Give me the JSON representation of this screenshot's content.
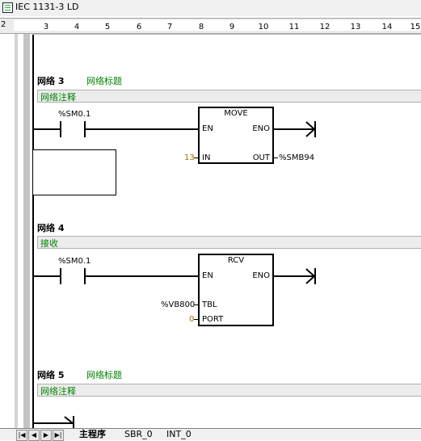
{
  "window": {
    "title": "IEC 1131-3 LD"
  },
  "ruler": {
    "start": "2",
    "ticks": [
      "3",
      "4",
      "5",
      "6",
      "7",
      "8",
      "9",
      "10",
      "11",
      "12",
      "13",
      "14",
      "15"
    ]
  },
  "networks": [
    {
      "title": "网络 3",
      "subtitle": "网络标题",
      "comment": "网络注释",
      "contact": "%SM0.1",
      "block": {
        "name": "MOVE",
        "en": "EN",
        "eno": "ENO",
        "in_pin": "IN",
        "in_value": "13",
        "out_pin": "OUT",
        "out_value": "%SMB94"
      }
    },
    {
      "title": "网络 4",
      "subtitle": "",
      "comment": "接收",
      "contact": "%SM0.1",
      "block": {
        "name": "RCV",
        "en": "EN",
        "eno": "ENO",
        "tbl_pin": "TBL",
        "tbl_value": "%VB800",
        "port_pin": "PORT",
        "port_value": "0"
      }
    },
    {
      "title": "网络 5",
      "subtitle": "网络标题",
      "comment": "网络注释"
    }
  ],
  "tabs": [
    "主程序",
    "SBR_0",
    "INT_0"
  ]
}
